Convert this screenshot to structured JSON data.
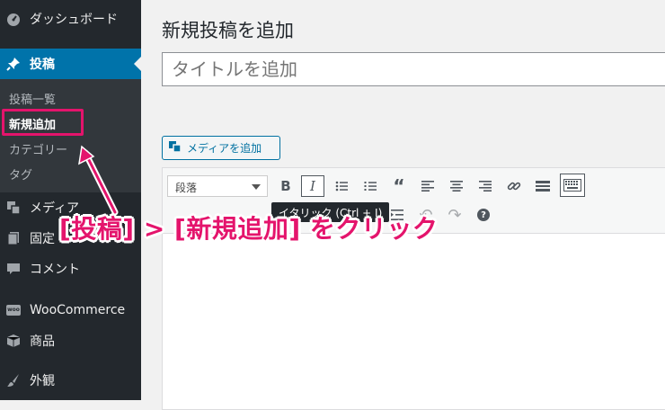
{
  "sidebar": {
    "dashboard": {
      "label": "ダッシュボード",
      "icon": "dashboard-icon"
    },
    "posts": {
      "label": "投稿",
      "icon": "pin-icon"
    },
    "submenu": [
      "投稿一覧",
      "新規追加",
      "カテゴリー",
      "タグ"
    ],
    "media": {
      "label": "メディア",
      "icon": "media-icon"
    },
    "pages": {
      "label": "固定",
      "icon": "page-icon"
    },
    "comments": {
      "label": "コメント",
      "icon": "comment-icon"
    },
    "woocommerce": {
      "label": "WooCommerce",
      "icon": "woo-icon",
      "icon_text": "woo"
    },
    "products": {
      "label": "商品",
      "icon": "box-icon"
    },
    "appearance": {
      "label": "外観",
      "icon": "brush-icon"
    }
  },
  "main": {
    "page_title": "新規投稿を追加",
    "title_placeholder": "タイトルを追加",
    "media_button": "メディアを追加",
    "format_select": "段落",
    "tooltip": "イタリック (Ctrl + I)"
  },
  "annotation": "[投稿] > [新規追加] をクリック",
  "colors": {
    "accent": "#e4146c",
    "admin_blue": "#0073aa",
    "sidebar": "#23282d"
  }
}
